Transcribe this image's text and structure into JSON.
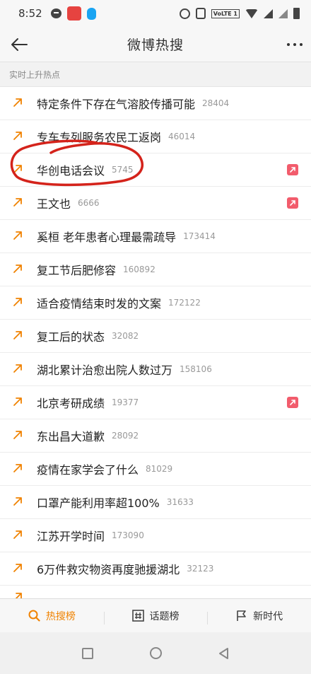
{
  "status_bar": {
    "time": "8:52",
    "network": "VoLTE 1"
  },
  "header": {
    "title": "微博热搜"
  },
  "section_label": "实时上升热点",
  "items": [
    {
      "title": "特定条件下存在气溶胶传播可能",
      "count": "28404",
      "up": false
    },
    {
      "title": "专车专列服务农民工返岗",
      "count": "46014",
      "up": false
    },
    {
      "title": "华创电话会议",
      "count": "5745",
      "up": true
    },
    {
      "title": "王文也",
      "count": "6666",
      "up": true
    },
    {
      "title": "奚桓 老年患者心理最需疏导",
      "count": "173414",
      "up": false
    },
    {
      "title": "复工节后肥修容",
      "count": "160892",
      "up": false
    },
    {
      "title": "适合疫情结束时发的文案",
      "count": "172122",
      "up": false
    },
    {
      "title": "复工后的状态",
      "count": "32082",
      "up": false
    },
    {
      "title": "湖北累计治愈出院人数过万",
      "count": "158106",
      "up": false
    },
    {
      "title": "北京考研成绩",
      "count": "19377",
      "up": true
    },
    {
      "title": "东出昌大道歉",
      "count": "28092",
      "up": false
    },
    {
      "title": "疫情在家学会了什么",
      "count": "81029",
      "up": false
    },
    {
      "title": "口罩产能利用率超100%",
      "count": "31633",
      "up": false
    },
    {
      "title": "江苏开学时间",
      "count": "173090",
      "up": false
    },
    {
      "title": "6万件救灾物资再度驰援湖北",
      "count": "32123",
      "up": false
    }
  ],
  "partial_item": {
    "title": ""
  },
  "tabs": [
    {
      "label": "热搜榜",
      "active": true,
      "icon": "search-flame-icon"
    },
    {
      "label": "话题榜",
      "active": false,
      "icon": "hashtag-icon"
    },
    {
      "label": "新时代",
      "active": false,
      "icon": "flag-icon"
    }
  ],
  "colors": {
    "accent": "#f08200",
    "up_badge": "#f25c6c",
    "annotation": "#d4231b"
  }
}
